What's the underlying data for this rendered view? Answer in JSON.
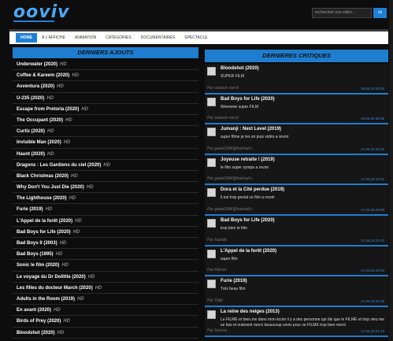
{
  "header": {
    "logo": "ooviv",
    "search_placeholder": "rechercher une vidéo...",
    "search_button": "ok"
  },
  "nav": [
    {
      "label": "HOME",
      "active": true
    },
    {
      "label": "À L'AFFICHE",
      "active": false
    },
    {
      "label": "ANIMATION",
      "active": false
    },
    {
      "label": "CATÉGORIES",
      "active": false
    },
    {
      "label": "DOCUMENTAIRES",
      "active": false
    },
    {
      "label": "SPECTACLE",
      "active": false
    }
  ],
  "left_panel": {
    "title": "DERNIERS AJOUTS",
    "films": [
      {
        "title": "Underwater (2020)",
        "badge": "HD"
      },
      {
        "title": "Coffee & Kareem (2020)",
        "badge": "HD"
      },
      {
        "title": "Avventura (2020)",
        "badge": "HD"
      },
      {
        "title": "U-235 (2020)",
        "badge": "HD"
      },
      {
        "title": "Escape from Pretoria (2020)",
        "badge": "HD"
      },
      {
        "title": "The Occupant (2020)",
        "badge": "HD"
      },
      {
        "title": "Curtiz (2020)",
        "badge": "HD"
      },
      {
        "title": "Invisible Man (2020)",
        "badge": "HD"
      },
      {
        "title": "Haunt (2020)",
        "badge": "HD"
      },
      {
        "title": "Dragons : Les Gardiens du ciel (2020)",
        "badge": "HD"
      },
      {
        "title": "Black Christmas (2020)",
        "badge": "HD"
      },
      {
        "title": "Why Don't You Just Die (2020)",
        "badge": "HD"
      },
      {
        "title": "The Lighthouse (2020)",
        "badge": "HD"
      },
      {
        "title": "Furie (2019)",
        "badge": "HD"
      },
      {
        "title": "L'Appel de la forêt (2020)",
        "badge": "HD"
      },
      {
        "title": "Bad Boys for Life (2020)",
        "badge": "HD"
      },
      {
        "title": "Bad Boys II (2003)",
        "badge": "HD"
      },
      {
        "title": "Bad Boys (1995)",
        "badge": "HD"
      },
      {
        "title": "Sonic le film (2020)",
        "badge": "HD"
      },
      {
        "title": "Le voyage du Dr Dolittle (2020)",
        "badge": "HD"
      },
      {
        "title": "Les filles du docteur March (2020)",
        "badge": "HD"
      },
      {
        "title": "Adults in the Room (2019)",
        "badge": "HD"
      },
      {
        "title": "En avant (2020)",
        "badge": "HD"
      },
      {
        "title": "Birds of Prey (2020)",
        "badge": "HD"
      },
      {
        "title": "Bloodshot (2020)",
        "badge": "HD"
      }
    ]
  },
  "right_panel": {
    "title": "DERNIERES CRITIQUES",
    "reviews": [
      {
        "title": "Bloodshot (2020)",
        "body": "SUPER FILM",
        "user": "Par wadson nervil",
        "date": "18.04.20 00:52"
      },
      {
        "title": "Bad Boys for Life (2020)",
        "body": "Weeeeee super FILM",
        "user": "Par wadson nervil",
        "date": "18.04.20 00:50"
      },
      {
        "title": "Jumanji : Next Level (2019)",
        "body": "super filme je les en jeux vidéo a revoir",
        "user": "Par gaele1984@hotmail.c",
        "date": "17.04.20 23:18"
      },
      {
        "title": "Joyeuse retraite ! (2019)",
        "body": "le film super sympa a revoir",
        "user": "Par gaele1984@hotmail.c",
        "date": "17.04.20 23:11"
      },
      {
        "title": "Dora et la Cité perdue (2019)",
        "body": "il est trop genial ce film a revoir",
        "user": "Par gaele1984@hotmail.c",
        "date": "17.04.20 23:09"
      },
      {
        "title": "Bad Boys for Life (2020)",
        "body": "trop bien le film",
        "user": "Par Famille",
        "date": "17.04.20 22:47"
      },
      {
        "title": "L'Appel de la forêt (2020)",
        "body": "super film",
        "user": "Par Pierrot",
        "date": "17.04.20 22:03"
      },
      {
        "title": "Furie (2019)",
        "body": "Très beau film",
        "user": "Par Tittié",
        "date": "17.04.20 21:25"
      },
      {
        "title": "La reine des neiges (2013)",
        "body": "Le FILME et bien,me dans mon école il y a des personne qui dis que le FILME et trop vieu me se fais et vraiment merci beaucoup ooviv pour se FILME trop bien merci",
        "user": "Par Sourou",
        "date": "17.04.20 21:10"
      }
    ]
  }
}
